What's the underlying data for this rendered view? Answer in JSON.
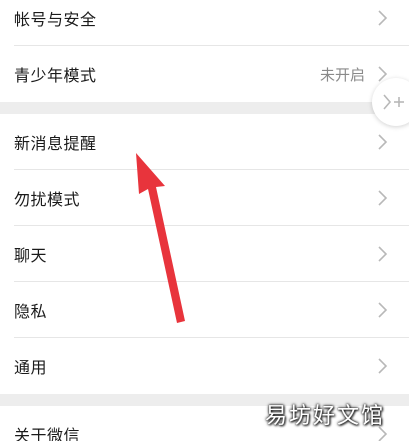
{
  "settings": {
    "group1": [
      {
        "label": "帐号与安全",
        "value": ""
      },
      {
        "label": "青少年模式",
        "value": "未开启"
      }
    ],
    "group2": [
      {
        "label": "新消息提醒",
        "value": ""
      },
      {
        "label": "勿扰模式",
        "value": ""
      },
      {
        "label": "聊天",
        "value": ""
      },
      {
        "label": "隐私",
        "value": ""
      },
      {
        "label": "通用",
        "value": ""
      }
    ],
    "group3": [
      {
        "label": "关于微信",
        "value": ""
      }
    ]
  },
  "annotation": {
    "arrow_color": "#e8343c",
    "target": "新消息提醒"
  },
  "watermark": {
    "text": "易坊好文馆"
  },
  "icons": {
    "row_chevron": "chevron-right-icon",
    "floater": "expand-icon"
  }
}
